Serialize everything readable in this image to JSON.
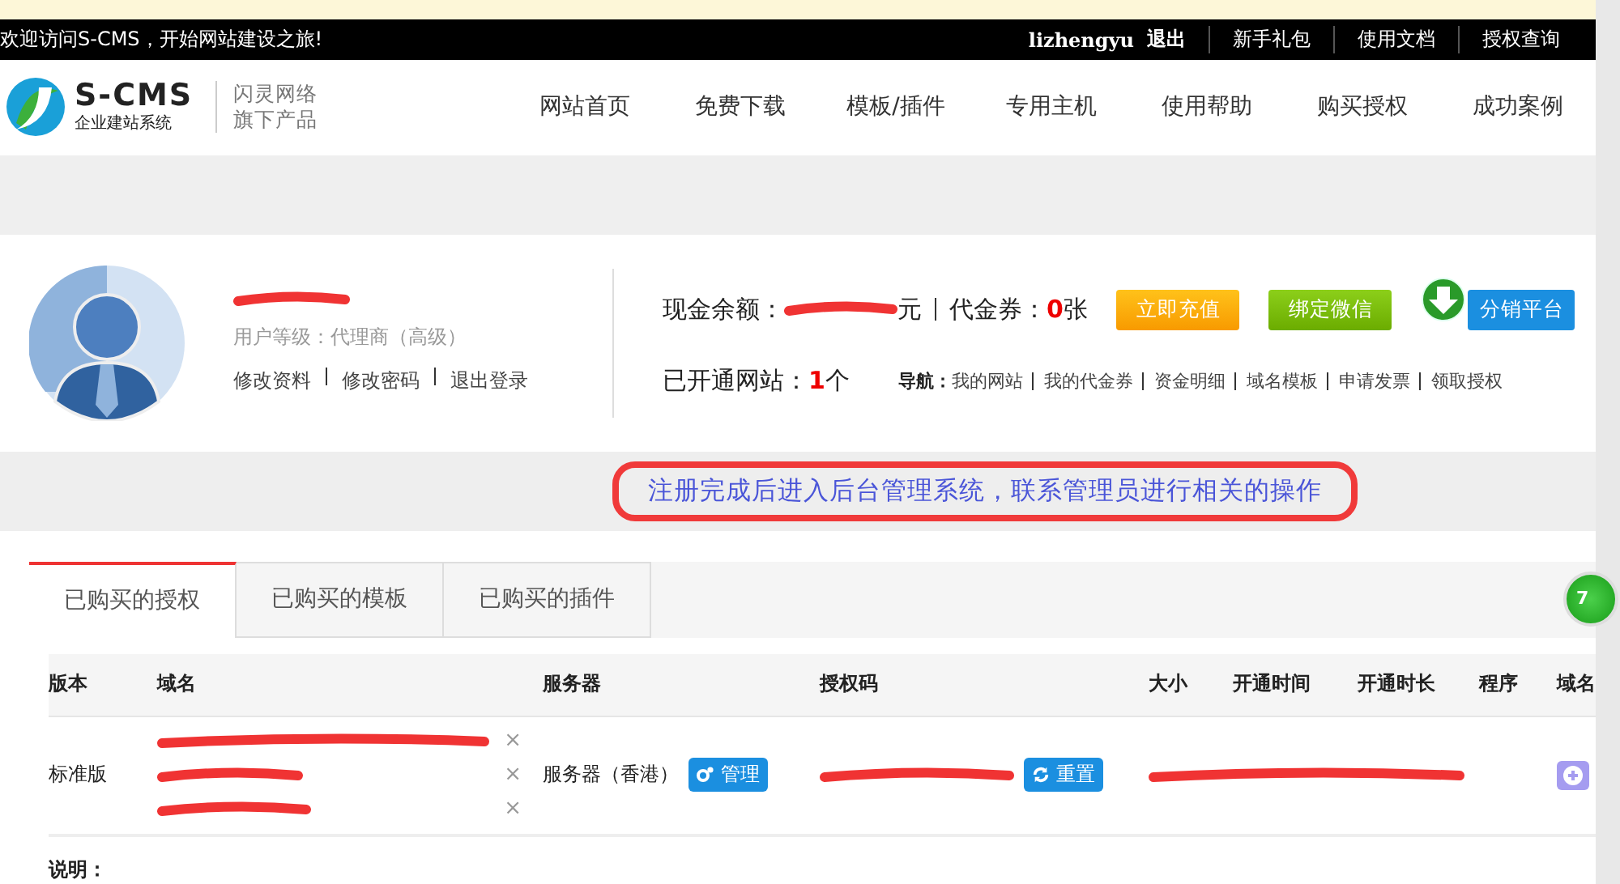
{
  "top_bar": {
    "welcome": "欢迎访问S-CMS，开始网站建设之旅!",
    "username": "lizhengyu",
    "logout": "退出",
    "links": [
      "新手礼包",
      "使用文档",
      "授权查询"
    ]
  },
  "header": {
    "logo_title": "S-CMS",
    "logo_subtitle": "企业建站系统",
    "brand_line1": "闪灵网络",
    "brand_line2": "旗下产品",
    "nav": [
      "网站首页",
      "免费下载",
      "模板/插件",
      "专用主机",
      "使用帮助",
      "购买授权",
      "成功案例"
    ]
  },
  "profile": {
    "user_level": "用户等级：代理商（高级）",
    "links": [
      "修改资料",
      "修改密码",
      "退出登录"
    ],
    "balance_label": "现金余额：",
    "balance_unit": "元",
    "voucher_label": "代金券：",
    "voucher_count": "0",
    "voucher_unit": "张",
    "buttons": [
      {
        "label": "立即充值",
        "kind": "orange"
      },
      {
        "label": "绑定微信",
        "kind": "green"
      },
      {
        "label": "分销平台",
        "kind": "blue"
      }
    ],
    "sites_label": "已开通网站：",
    "sites_count": "1",
    "sites_unit": "个",
    "guide_label": "导航：",
    "guide_links": [
      "我的网站",
      "我的代金券",
      "资金明细",
      "域名模板",
      "申请发票",
      "领取授权"
    ]
  },
  "notice": "注册完成后进入后台管理系统，联系管理员进行相关的操作",
  "tabs": [
    {
      "label": "已购买的授权",
      "selected": true
    },
    {
      "label": "已购买的模板",
      "selected": false
    },
    {
      "label": "已购买的插件",
      "selected": false
    }
  ],
  "side_badge": "7",
  "table": {
    "columns": [
      "版本",
      "域名",
      "服务器",
      "授权码",
      "大小",
      "开通时间",
      "开通时长",
      "程序",
      "域名"
    ],
    "rows": [
      {
        "edition": "标准版",
        "domains": [
          {
            "remove": "×"
          },
          {
            "remove": "×"
          },
          {
            "remove": "×"
          }
        ],
        "server": "服务器（香港）",
        "manage_button": "管理",
        "reset_button": "重置"
      }
    ]
  },
  "footer_label": "说明："
}
